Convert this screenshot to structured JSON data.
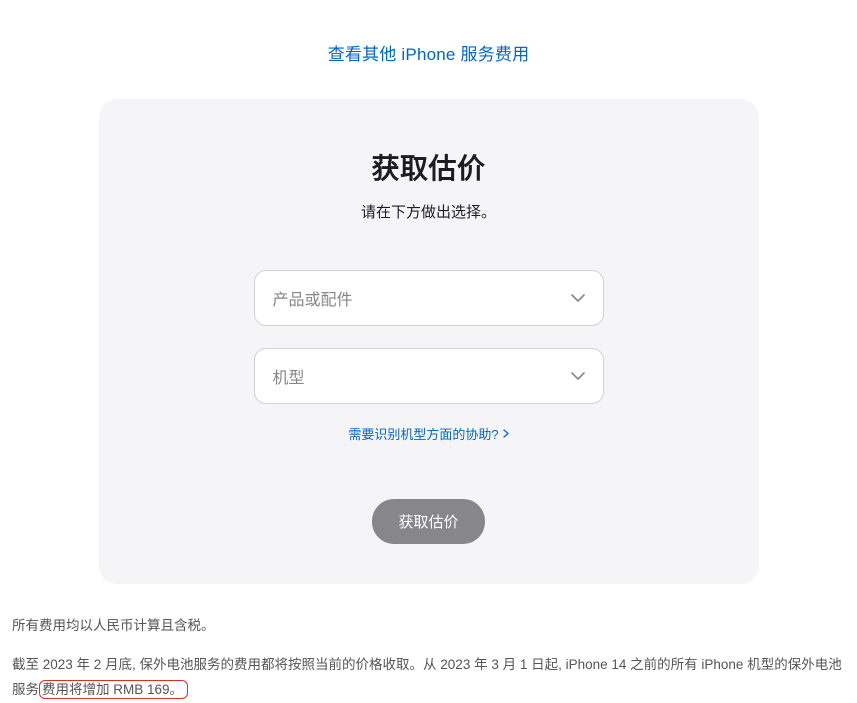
{
  "topLink": {
    "label": "查看其他 iPhone 服务费用"
  },
  "card": {
    "title": "获取估价",
    "subtitle": "请在下方做出选择。",
    "select1": {
      "placeholder": "产品或配件"
    },
    "select2": {
      "placeholder": "机型"
    },
    "helpLink": {
      "label": "需要识别机型方面的协助?"
    },
    "submit": {
      "label": "获取估价"
    }
  },
  "footer": {
    "line1": "所有费用均以人民币计算且含税。",
    "line2_pre": "截至 2023 年 2 月底, 保外电池服务的费用都将按照当前的价格收取。从 2023 年 3 月 1 日起, iPhone 14 之前的所有 iPhone 机型的保外电池服务",
    "line2_highlight": "费用将增加 RMB 169。"
  }
}
